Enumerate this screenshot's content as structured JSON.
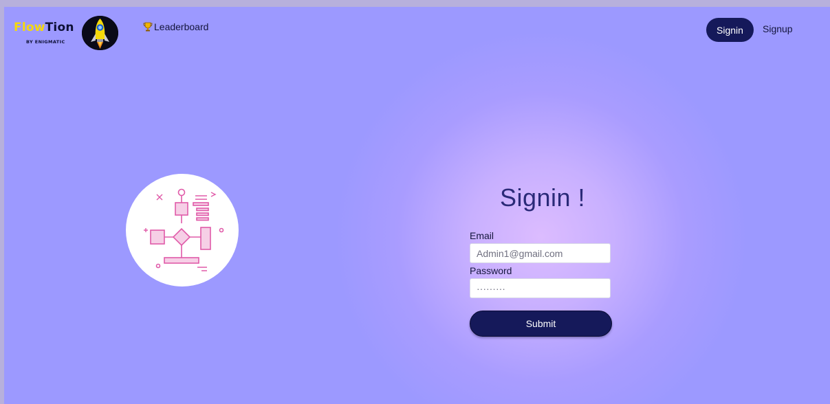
{
  "brand": {
    "name_part1": "Flow",
    "name_part2": "Tion",
    "tagline": "BY ENIGMATIC",
    "logo_icon": "rocket-icon"
  },
  "nav": {
    "leaderboard_label": "Leaderboard",
    "leaderboard_icon": "trophy-icon",
    "signin_label": "Signin",
    "signup_label": "Signup"
  },
  "illustration": {
    "icon": "flowchart-icon"
  },
  "form": {
    "title": "Signin !",
    "email_label": "Email",
    "email_value": "Admin1@gmail.com",
    "password_label": "Password",
    "password_value": "·········",
    "submit_label": "Submit"
  },
  "colors": {
    "background": "#9c99ff",
    "glow": "#dcbcff",
    "primary_button": "#15195a",
    "brand_yellow": "#f5d90a",
    "flowchart_pink": "#e05aa8"
  }
}
